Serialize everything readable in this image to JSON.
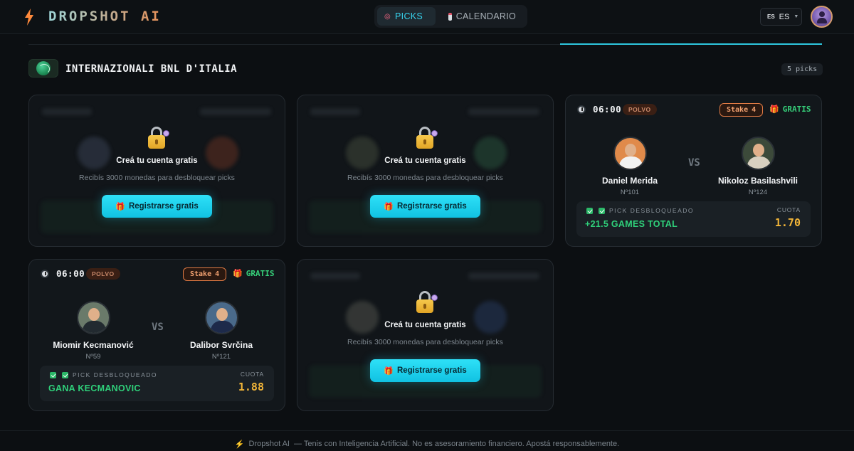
{
  "header": {
    "brand": "DROPSHOT AI",
    "nav": {
      "picks_label": "PICKS",
      "calendar_label": "CALENDARIO"
    },
    "language": {
      "code_small": "ES",
      "code": "ES"
    }
  },
  "tournament": {
    "name": "INTERNAZIONALI BNL D'ITALIA",
    "count_label": "5 picks"
  },
  "locked_card": {
    "title": "Creá tu cuenta gratis",
    "subtitle": "Recibís 3000 monedas para desbloquear picks",
    "button_label": "Registrarse gratis"
  },
  "matches": [
    {
      "time": "06:00",
      "surface": "POLVO",
      "stake_label": "Stake",
      "stake_value": "4",
      "free_label": "GRATIS",
      "player1": {
        "name": "Daniel Merida",
        "rank": "Nº101"
      },
      "player2": {
        "name": "Nikoloz Basilashvili",
        "rank": "Nº124"
      },
      "vs": "VS",
      "pick_status": "PICK DESBLOQUEADO",
      "pick": "+21.5 GAMES TOTAL",
      "odds_label": "CUOTA",
      "odds": "1.70"
    },
    {
      "time": "06:00",
      "surface": "POLVO",
      "stake_label": "Stake",
      "stake_value": "4",
      "free_label": "GRATIS",
      "player1": {
        "name": "Miomir Kecmanović",
        "rank": "Nº59"
      },
      "player2": {
        "name": "Dalibor Svrčina",
        "rank": "Nº121"
      },
      "vs": "VS",
      "pick_status": "PICK DESBLOQUEADO",
      "pick": "GANA KECMANOVIC",
      "odds_label": "CUOTA",
      "odds": "1.88"
    }
  ],
  "footer": {
    "brand": "Dropshot AI",
    "text": "— Tenis con Inteligencia Artificial. No es asesoramiento financiero. Apostá responsablemente."
  },
  "colors": {
    "accent": "#2ec6dd",
    "win": "#2fd07a",
    "odds": "#f2b538",
    "stake": "#e07a44"
  }
}
